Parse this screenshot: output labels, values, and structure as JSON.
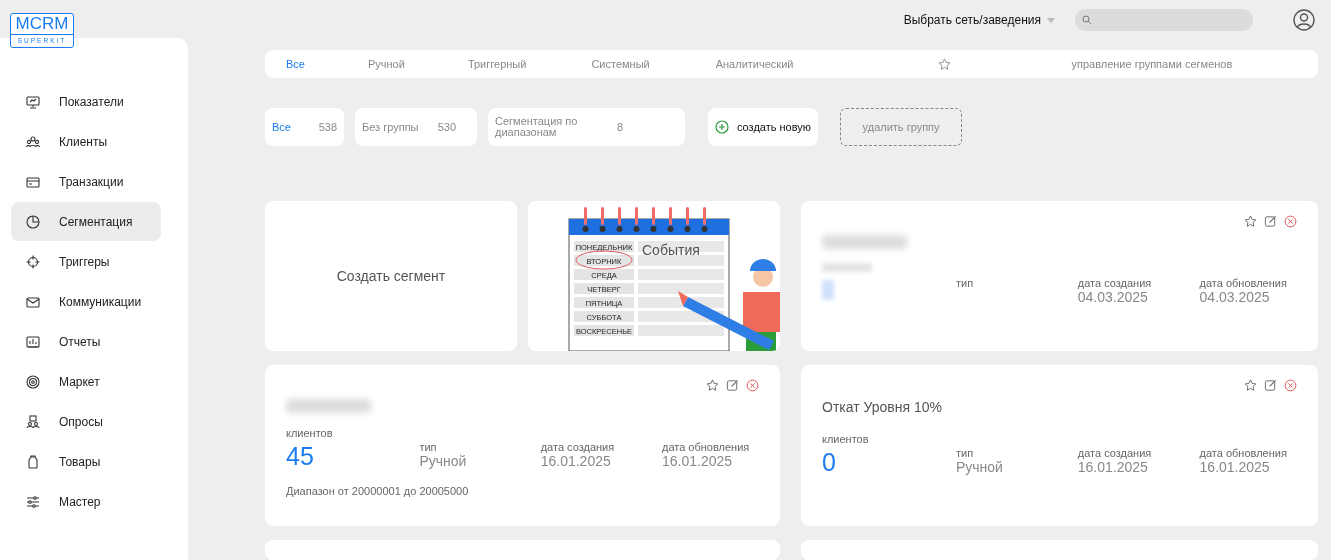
{
  "logo": {
    "title": "MCRM",
    "subtitle": "SUPERKIT"
  },
  "sidebar": {
    "items": [
      {
        "label": "Показатели",
        "selected": false
      },
      {
        "label": "Клиенты",
        "selected": false
      },
      {
        "label": "Транзакции",
        "selected": false
      },
      {
        "label": "Сегментация",
        "selected": true
      },
      {
        "label": "Триггеры",
        "selected": false
      },
      {
        "label": "Коммуникации",
        "selected": false
      },
      {
        "label": "Отчеты",
        "selected": false
      },
      {
        "label": "Маркет",
        "selected": false
      },
      {
        "label": "Опросы",
        "selected": false
      },
      {
        "label": "Товары",
        "selected": false
      },
      {
        "label": "Мастер",
        "selected": false
      }
    ]
  },
  "topbar": {
    "network_select": "Выбрать сеть/заведения"
  },
  "tabs": [
    {
      "label": "Все",
      "selected": true
    },
    {
      "label": "Ручной",
      "selected": false
    },
    {
      "label": "Триггерный",
      "selected": false
    },
    {
      "label": "Системный",
      "selected": false
    },
    {
      "label": "Аналитический",
      "selected": false
    }
  ],
  "manage_groups_link": "управление группами сегменов",
  "groups": [
    {
      "label": "Все",
      "count": "538",
      "selected": true
    },
    {
      "label": "Без группы",
      "count": "530",
      "selected": false
    },
    {
      "label": "Сегментация по диапазонам",
      "count": "8",
      "selected": false
    }
  ],
  "create_group_button": "создать новую",
  "delete_group_button": "удалить группу",
  "create_segment_card": "Создать сегмент",
  "events_card": {
    "title": "События",
    "days": [
      "ПОНЕДЕЛЬНИК",
      "ВТОРНИК",
      "СРЕДА",
      "ЧЕТВЕРГ",
      "ПЯТНИЦА",
      "СУББОТА",
      "ВОСКРЕСЕНЬЕ"
    ]
  },
  "segments": [
    {
      "blurred": true,
      "type_label": "тип",
      "created_label": "дата создания",
      "created": "04.03.2025",
      "updated_label": "дата обновления",
      "updated": "04.03.2025"
    },
    {
      "blurred": true,
      "clients_label": "клиентов",
      "clients": "45",
      "type_label": "тип",
      "type": "Ручной",
      "created_label": "дата создания",
      "created": "16.01.2025",
      "updated_label": "дата обновления",
      "updated": "16.01.2025",
      "note": "Диапазон от 20000001 до 20005000"
    },
    {
      "blurred": false,
      "title": "Откат Уровня 10%",
      "clients_label": "клиентов",
      "clients": "0",
      "type_label": "тип",
      "type": "Ручной",
      "created_label": "дата создания",
      "created": "16.01.2025",
      "updated_label": "дата обновления",
      "updated": "16.01.2025"
    }
  ]
}
